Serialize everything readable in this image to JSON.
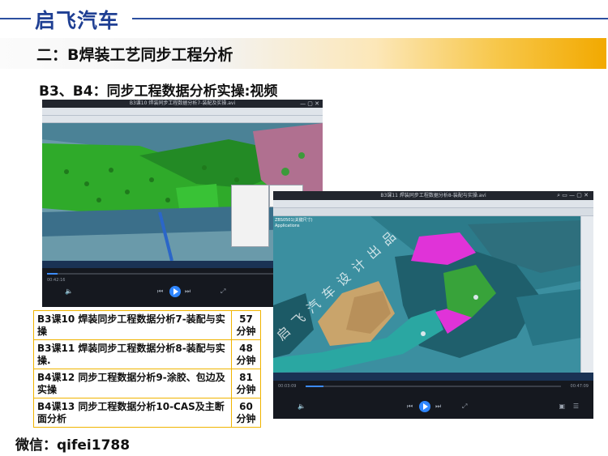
{
  "brand": {
    "name": "启飞汽车"
  },
  "section_title": "二：B焊装工艺同步工程分析",
  "subtitle": "B3、B4：同步工程数据分析实操:视频",
  "videos": [
    {
      "window_title": "B3课10 焊装同步工程数据分析7-装配及实操.avi",
      "time_elapsed": "00:42:16",
      "time_total": ""
    },
    {
      "window_title": "B3课11 焊装同步工程数据分析8-装配与实操.avi",
      "time_elapsed": "00:03:09",
      "time_total": "00:47:09",
      "watermark": "启飞汽车设计出品",
      "tree_items": [
        "ZBS0501(关键尺寸)",
        "Applications"
      ]
    }
  ],
  "courses": [
    {
      "name": "B3课10 焊装同步工程数据分析7-装配与实操",
      "duration": "57",
      "unit": "分钟"
    },
    {
      "name": "B3课11 焊装同步工程数据分析8-装配与实操.",
      "duration": "48",
      "unit": "分钟"
    },
    {
      "name": "B4课12 同步工程数据分析9-涂胶、包边及实操",
      "duration": "81",
      "unit": "分钟"
    },
    {
      "name": "B4课13 同步工程数据分析10-CAS及主断面分析",
      "duration": "60",
      "unit": "分钟"
    }
  ],
  "footer": {
    "label": "微信：",
    "value": "qifei1788"
  },
  "colors": {
    "brand_blue": "#1f3f93",
    "banner_gold": "#f2a900",
    "table_border": "#f0b400",
    "weld_green": "#2fae2a",
    "part_magenta": "#e033d8",
    "part_teal": "#2aa7a2"
  }
}
